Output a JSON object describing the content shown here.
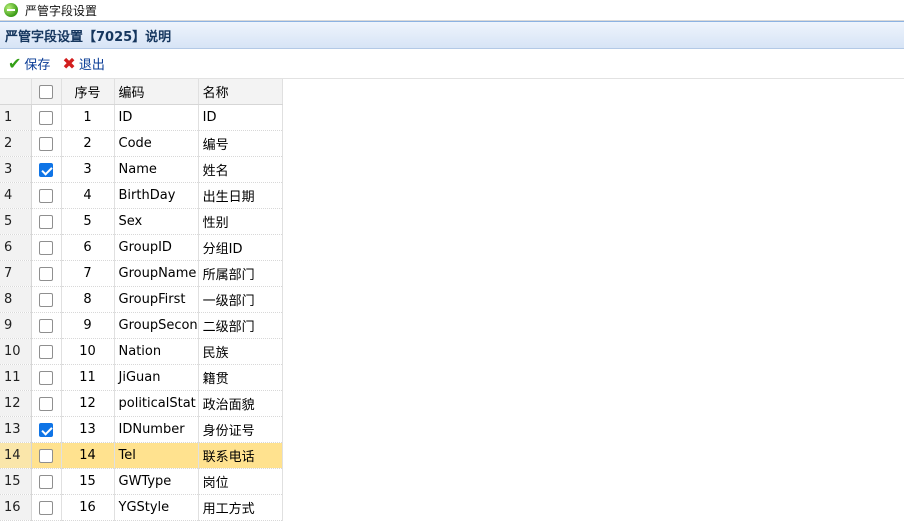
{
  "window": {
    "title": "严管字段设置"
  },
  "panel": {
    "title": "严管字段设置【7025】说明"
  },
  "toolbar": {
    "save_label": "保存",
    "exit_label": "退出"
  },
  "table": {
    "headers": {
      "seq": "序号",
      "code": "编码",
      "name": "名称"
    },
    "rows": [
      {
        "rownum": "1",
        "checked": false,
        "seq": "1",
        "code": "ID",
        "name": "ID"
      },
      {
        "rownum": "2",
        "checked": false,
        "seq": "2",
        "code": "Code",
        "name": "编号"
      },
      {
        "rownum": "3",
        "checked": true,
        "seq": "3",
        "code": "Name",
        "name": "姓名"
      },
      {
        "rownum": "4",
        "checked": false,
        "seq": "4",
        "code": "BirthDay",
        "name": "出生日期"
      },
      {
        "rownum": "5",
        "checked": false,
        "seq": "5",
        "code": "Sex",
        "name": "性别"
      },
      {
        "rownum": "6",
        "checked": false,
        "seq": "6",
        "code": "GroupID",
        "name": "分组ID"
      },
      {
        "rownum": "7",
        "checked": false,
        "seq": "7",
        "code": "GroupName",
        "name": "所属部门"
      },
      {
        "rownum": "8",
        "checked": false,
        "seq": "8",
        "code": "GroupFirst",
        "name": "一级部门"
      },
      {
        "rownum": "9",
        "checked": false,
        "seq": "9",
        "code": "GroupSecon",
        "name": "二级部门"
      },
      {
        "rownum": "10",
        "checked": false,
        "seq": "10",
        "code": "Nation",
        "name": "民族"
      },
      {
        "rownum": "11",
        "checked": false,
        "seq": "11",
        "code": "JiGuan",
        "name": "籍贯"
      },
      {
        "rownum": "12",
        "checked": false,
        "seq": "12",
        "code": "politicalStat",
        "name": "政治面貌"
      },
      {
        "rownum": "13",
        "checked": true,
        "seq": "13",
        "code": "IDNumber",
        "name": "身份证号"
      },
      {
        "rownum": "14",
        "checked": false,
        "seq": "14",
        "code": "Tel",
        "name": "联系电话",
        "highlighted": true
      },
      {
        "rownum": "15",
        "checked": false,
        "seq": "15",
        "code": "GWType",
        "name": "岗位"
      },
      {
        "rownum": "16",
        "checked": false,
        "seq": "16",
        "code": "YGStyle",
        "name": "用工方式"
      }
    ]
  }
}
